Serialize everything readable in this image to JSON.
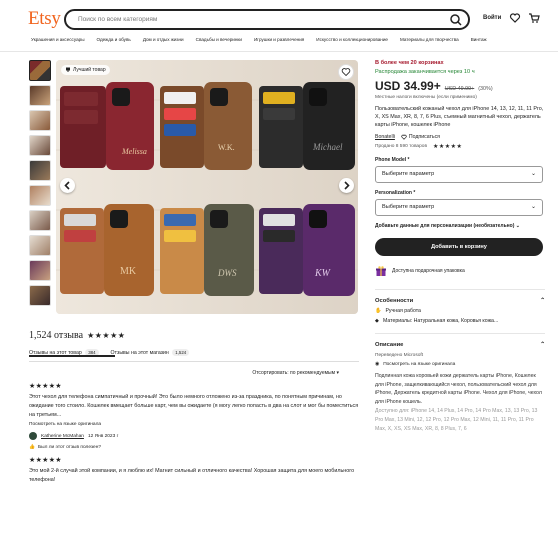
{
  "header": {
    "logo": "Etsy",
    "search_placeholder": "Поиск по всем категориям",
    "signin": "Войти",
    "categories": [
      "Украшения и аксессуары",
      "Одежда и обувь",
      "Дом и отдых жизни",
      "Свадьбы и вечеринки",
      "Игрушки и развлечения",
      "Искусство и коллекционирование",
      "Материалы для творчества",
      "Винтаж"
    ]
  },
  "gallery": {
    "popular_badge": "Лучший товар"
  },
  "product": {
    "in_baskets": "В более чем 20 корзинах",
    "sale_ends": "Распродажа заканчивается через 10 ч",
    "price": "USD 34.99+",
    "old_price": "USD 49.99+",
    "discount": "(30%)",
    "tax_note": "Местные налоги включены (если применимо)",
    "title": "Пользовательский кожаный чехол для iPhone 14, 13, 12, 11, 11 Pro, X, XS Max, XR, 8, 7, 6 Plus, съемный магнитный чехол, держатель карты iPhone, кошелек iPhone",
    "shop_name": "Bonatelli",
    "follow": "Подписаться",
    "sales": "Продано 8 590 товаров",
    "stars": "★★★★★",
    "phone_model_label": "Phone Model *",
    "personalization_label": "Personalization *",
    "select_placeholder": "Выберите параметр",
    "add_personalization": "Добавьте данные для персонализации (необязательно)",
    "cart_button": "Добавить в корзину",
    "gift_wrap": "Доступна подарочная упаковка"
  },
  "features": {
    "heading": "Особенности",
    "items": [
      "Ручная работа",
      "Материалы: Натуральная кожа, Коровья кожа..."
    ]
  },
  "description": {
    "heading": "Описание",
    "translated_by": "Переведено Microsoft",
    "show_original": "Посмотреть на языке оригинала",
    "text": "Подлинная кожа коровьей кожи держатель карты iPhone, Кошелек для iPhone, защелкивающийся чехол, пользовательский чехол для iPhone, Держатель кредитной карты iPhone. Чехол для iPhone, чехол для iPhone кошель.",
    "text_fade": "Доступно для: iPhone 14, 14 Plus, 14 Pro, 14 Pro Max, 13, 13 Pro, 13 Pro Max, 13 Mini, 12, 12 Pro, 12 Pro Max, 12 Mini, 11, 11 Pro, 11 Pro Max, X, XS, XS Max, XR, 8, 8 Plus, 7, 6"
  },
  "reviews": {
    "count": "1,524 отзыва",
    "stars": "★★★★★",
    "tab_item": "Отзывы на этот товар",
    "tab_item_count": "384",
    "tab_shop": "Отзывы на этот магазин",
    "tab_shop_count": "1,524",
    "sort": "Отсортировать: по рекомендуемым",
    "list": [
      {
        "stars": "★★★★★",
        "text": "Этот чехол для телефона симпатичный и прочный! Это было немного отложено из-за праздника, по понятным причинам, но ожидание того стоило. Кошелек вмещает больше карт, чем вы ожидаете (я могу легко попасть в два на слот и мог бы поместиться на третьем...",
        "original": "Посмотреть на языке оригинала",
        "user": "Katherine McMahan",
        "date": "12 Янв 2023 г",
        "helpful": "Был ли этот отзыв полезен?"
      },
      {
        "stars": "★★★★★",
        "text": "Это мой 2-й случай этой компании, и я люблю их! Магнит сильный и отличного качества! Хорошая защита для моего мобильного телефона!"
      }
    ]
  },
  "colors": {
    "accent": "#f1641e",
    "sale_red": "#a61a2e",
    "sale_green": "#258635"
  }
}
